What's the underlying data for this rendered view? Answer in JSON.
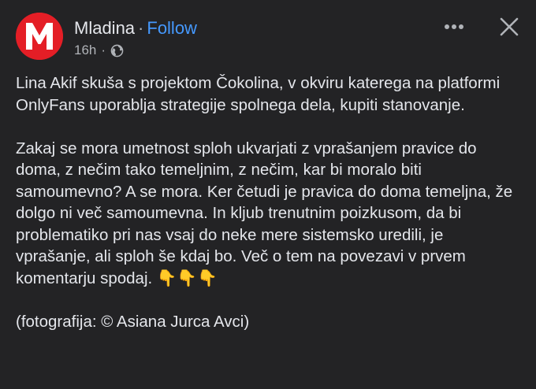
{
  "header": {
    "page_name": "Mladina",
    "separator": "·",
    "follow_label": "Follow",
    "time": "16h",
    "meta_dot": "·",
    "privacy_icon": "globe-icon",
    "avatar_letter": "M",
    "avatar_color": "#e41e26"
  },
  "actions": {
    "more_icon": "more-horizontal-icon",
    "close_icon": "close-icon"
  },
  "post": {
    "paragraph_1": "Lina Akif skuša s projektom Čokolina, v okviru katerega na platformi OnlyFans uporablja strategije spolnega dela, kupiti stanovanje.",
    "paragraph_2": "Zakaj se mora umetnost sploh ukvarjati z vprašanjem pravice do doma, z nečim tako temeljnim, z nečim, kar bi moralo biti samoumevno? A se mora. Ker četudi je pravica do doma temeljna, že dolgo ni več samoumevna. In kljub trenutnim poizkusom, da bi problematiko pri nas vsaj do neke mere sistemsko uredili, je vprašanje, ali sploh še kdaj bo. Več o tem na povezavi v prvem komentarju spodaj. 👇👇👇",
    "paragraph_3": "(fotografija: © Asiana Jurca Avci)"
  },
  "colors": {
    "background": "#232325",
    "text": "#e4e6eb",
    "secondary_text": "#b0b3b8",
    "link": "#4599ff"
  }
}
